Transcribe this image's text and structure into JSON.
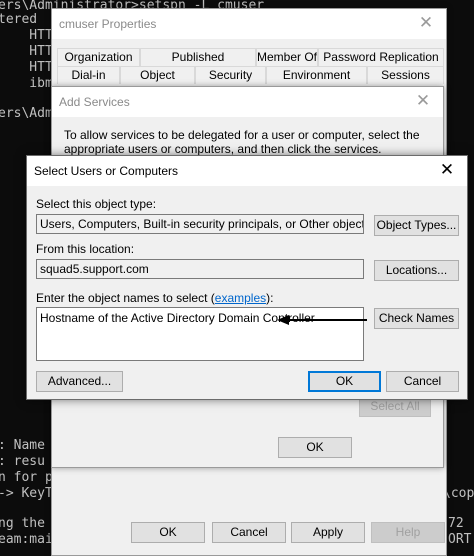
{
  "console": {
    "lines": [
      "ers\\Administrator>setspn -L cmuser",
      "tered",
      "    HTT",
      "    HTT",
      "    HTT",
      "    ibm",
      "ers\\Adm",
      ": Name",
      ": resu",
      "n for p",
      "-> KeyT",
      "ng the",
      "eam:mai"
    ],
    "right_lines": [
      "\\cop",
      "72",
      "ORT"
    ]
  },
  "properties_window": {
    "title": "cmuser Properties",
    "tabs_row1": [
      "Organization",
      "Published Certificates",
      "Member Of",
      "Password Replication"
    ],
    "tabs_row2": [
      "Dial-in",
      "Object",
      "Security",
      "Environment",
      "Sessions"
    ],
    "ok_label": "OK",
    "cancel_label": "Cancel",
    "apply_label": "Apply",
    "help_label": "Help"
  },
  "add_services_window": {
    "title": "Add Services",
    "instructions": "To allow services to be delegated for a user or computer, select the appropriate users or computers, and then click the services.",
    "select_all_label": "Select All",
    "ok_label": "OK"
  },
  "select_users_dialog": {
    "title": "Select Users or Computers",
    "object_type_label": "Select this object type:",
    "object_type_value": "Users, Computers, Built-in security principals, or Other objects",
    "object_types_button": "Object Types...",
    "location_label": "From this location:",
    "location_value": "squad5.support.com",
    "locations_button": "Locations...",
    "names_label_prefix": "Enter the object names to select (",
    "names_label_link": "examples",
    "names_label_suffix": "):",
    "names_value": "Hostname of the Active Directory Domain Controller",
    "check_names_button": "Check Names",
    "advanced_button": "Advanced...",
    "ok_button": "OK",
    "cancel_button": "Cancel"
  },
  "colors": {
    "accent": "#0078d7",
    "link": "#0066cc",
    "console_bg": "#0c0c0c",
    "console_text": "#c0c0c0"
  }
}
